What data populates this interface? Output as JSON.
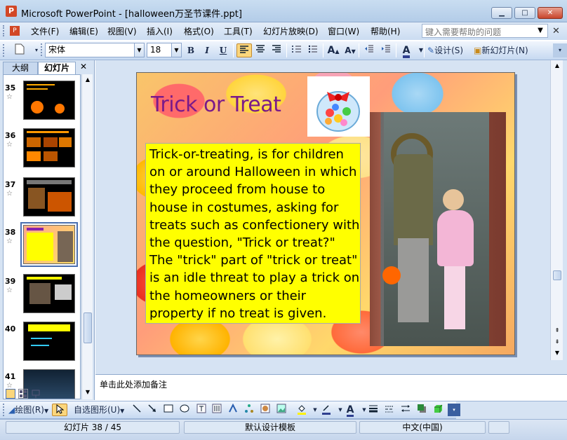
{
  "window": {
    "title": "Microsoft PowerPoint - [halloween万圣节课件.ppt]",
    "app_icon": "P",
    "minimize_glyph": "▁",
    "maximize_glyph": "□",
    "close_glyph": "✕"
  },
  "menu": {
    "items": [
      "文件(F)",
      "编辑(E)",
      "视图(V)",
      "插入(I)",
      "格式(O)",
      "工具(T)",
      "幻灯片放映(D)",
      "窗口(W)",
      "帮助(H)"
    ],
    "help_placeholder": "键入需要帮助的问题",
    "close_glyph": "✕"
  },
  "toolbar": {
    "font_name": "宋体",
    "font_size": "18",
    "bold": "B",
    "italic": "I",
    "underline": "U",
    "grow_font": "A",
    "shrink_font": "A",
    "font_color": "A",
    "design_label": "设计(S)",
    "new_slide_label": "新幻灯片(N)"
  },
  "left_panel": {
    "tab_outline": "大纲",
    "tab_slides": "幻灯片",
    "close_glyph": "✕",
    "thumbnails": [
      {
        "number": "35",
        "star": "☆"
      },
      {
        "number": "36",
        "star": "☆"
      },
      {
        "number": "37",
        "star": "☆"
      },
      {
        "number": "38",
        "star": "☆"
      },
      {
        "number": "39",
        "star": "☆"
      },
      {
        "number": "40",
        "star": ""
      },
      {
        "number": "41",
        "star": "☆"
      }
    ],
    "selected_slide": "38"
  },
  "slide": {
    "title": "Trick or Treat",
    "body": "Trick-or-treating, is for children on or around Halloween in which they proceed from house to house in costumes, asking for treats such as confectionery with the question, \"Trick or treat?\" The \"trick\" part of \"trick or treat\" is an idle threat to play a trick on the homeowners or their property if no treat is given."
  },
  "notes": {
    "placeholder": "单击此处添加备注"
  },
  "drawbar": {
    "draw_label": "绘图(R)",
    "autoshape_label": "自选图形(U)"
  },
  "status": {
    "slide_count": "幻灯片 38 / 45",
    "template": "默认设计模板",
    "language": "中文(中国)"
  },
  "colors": {
    "title_purple": "#7a1a8a",
    "textbox_yellow": "#ffff00",
    "chrome_blue": "#c9ddf1"
  }
}
